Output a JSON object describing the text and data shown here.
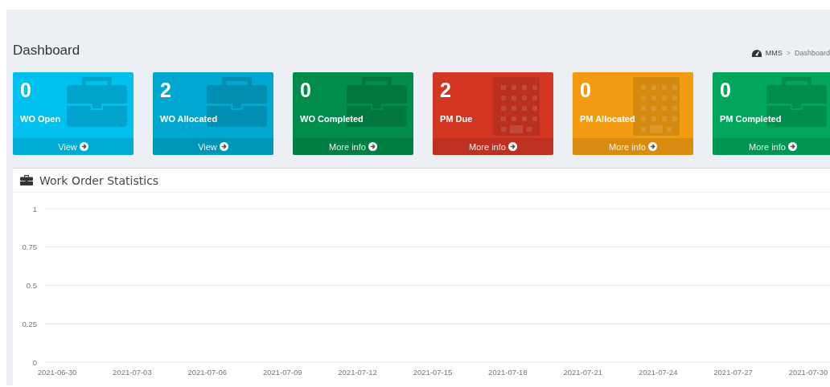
{
  "page_title": "Dashboard",
  "breadcrumb": {
    "items": [
      "MMS",
      "Dashboard"
    ],
    "separator": ">"
  },
  "cards": [
    {
      "value": "0",
      "label": "WO Open",
      "link": "View",
      "color": "#00c0ef",
      "kind": "briefcase"
    },
    {
      "value": "2",
      "label": "WO Allocated",
      "link": "View",
      "color": "#00a7d0",
      "kind": "briefcase"
    },
    {
      "value": "0",
      "label": "WO Completed",
      "link": "More info",
      "color": "#008d4c",
      "kind": "briefcase"
    },
    {
      "value": "2",
      "label": "PM Due",
      "link": "More info",
      "color": "#d33724",
      "kind": "building"
    },
    {
      "value": "0",
      "label": "PM Allocated",
      "link": "More info",
      "color": "#f39c12",
      "kind": "building"
    },
    {
      "value": "0",
      "label": "PM Completed",
      "link": "More info",
      "color": "#00a65a",
      "kind": "briefcase"
    }
  ],
  "panel": {
    "title": "Work Order Statistics",
    "chart_data": {
      "type": "line",
      "ylim": [
        0,
        1
      ],
      "yticks": [
        0,
        0.25,
        0.5,
        0.75,
        1
      ],
      "grid": true,
      "categories": [
        "2021-06-30",
        "2021-07-03",
        "2021-07-06",
        "2021-07-09",
        "2021-07-12",
        "2021-07-15",
        "2021-07-18",
        "2021-07-21",
        "2021-07-24",
        "2021-07-27",
        "2021-07-30"
      ]
    }
  }
}
